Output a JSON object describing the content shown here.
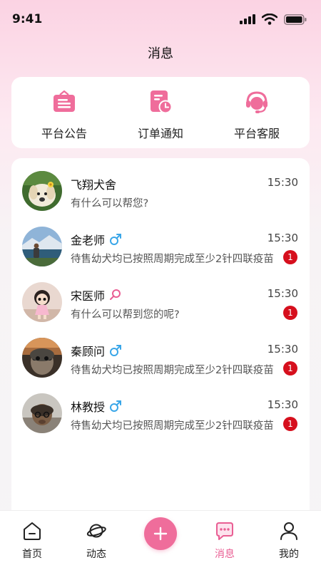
{
  "status_bar": {
    "time": "9:41",
    "icons": [
      "signal-icon",
      "wifi-icon",
      "battery-icon"
    ]
  },
  "header": {
    "title": "消息"
  },
  "quick_actions": [
    {
      "label": "平台公告",
      "icon": "announcement-icon"
    },
    {
      "label": "订单通知",
      "icon": "order-notification-icon"
    },
    {
      "label": "平台客服",
      "icon": "customer-service-icon"
    }
  ],
  "messages": [
    {
      "name": "飞翔犬舍",
      "time": "15:30",
      "preview": "有什么可以帮您?",
      "gender": "",
      "unread": ""
    },
    {
      "name": "金老师",
      "time": "15:30",
      "preview": "待售幼犬均已按照周期完成至少2针四联疫苗",
      "gender": "male",
      "unread": "1"
    },
    {
      "name": "宋医师",
      "time": "15:30",
      "preview": "有什么可以帮到您的呢?",
      "gender": "female",
      "unread": "1"
    },
    {
      "name": "秦顾问",
      "time": "15:30",
      "preview": "待售幼犬均已按照周期完成至少2针四联疫苗",
      "gender": "male",
      "unread": "1"
    },
    {
      "name": "林教授",
      "time": "15:30",
      "preview": "待售幼犬均已按照周期完成至少2针四联疫苗",
      "gender": "male",
      "unread": "1"
    }
  ],
  "bottom_nav": [
    {
      "label": "首页",
      "icon": "home-icon",
      "active": false
    },
    {
      "label": "动态",
      "icon": "planet-icon",
      "active": false
    },
    {
      "label": "",
      "icon": "plus-icon",
      "active": false
    },
    {
      "label": "消息",
      "icon": "message-icon",
      "active": true
    },
    {
      "label": "我的",
      "icon": "profile-icon",
      "active": false
    }
  ],
  "colors": {
    "accent": "#ef6d9b",
    "accent_text": "#e95e93",
    "badge": "#d60f1d",
    "male": "#39a6e8",
    "female": "#e95e93"
  }
}
